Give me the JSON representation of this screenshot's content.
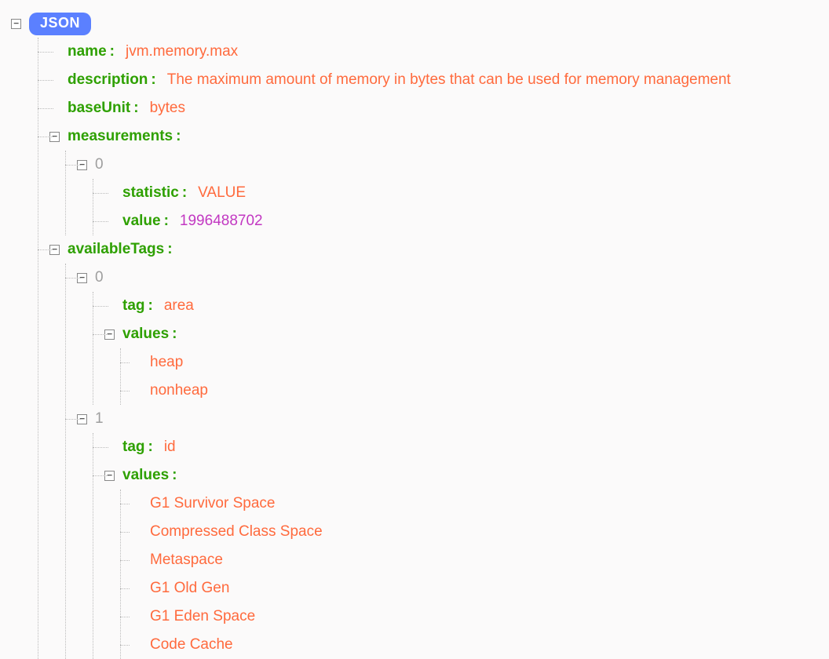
{
  "rootBadge": "JSON",
  "glyphs": {
    "minus": "−"
  },
  "fields": {
    "name": {
      "key": "name",
      "value": "jvm.memory.max"
    },
    "description": {
      "key": "description",
      "value": "The maximum amount of memory in bytes that can be used for memory management"
    },
    "baseUnit": {
      "key": "baseUnit",
      "value": "bytes"
    },
    "measurements": {
      "key": "measurements",
      "items": [
        {
          "indexLabel": "0",
          "statistic": {
            "key": "statistic",
            "value": "VALUE"
          },
          "value": {
            "key": "value",
            "value": "1996488702"
          }
        }
      ]
    },
    "availableTags": {
      "key": "availableTags",
      "items": [
        {
          "indexLabel": "0",
          "tag": {
            "key": "tag",
            "value": "area"
          },
          "values": {
            "key": "values",
            "list": [
              "heap",
              "nonheap"
            ]
          }
        },
        {
          "indexLabel": "1",
          "tag": {
            "key": "tag",
            "value": "id"
          },
          "values": {
            "key": "values",
            "list": [
              "G1 Survivor Space",
              "Compressed Class Space",
              "Metaspace",
              "G1 Old Gen",
              "G1 Eden Space",
              "Code Cache"
            ]
          }
        }
      ]
    }
  }
}
